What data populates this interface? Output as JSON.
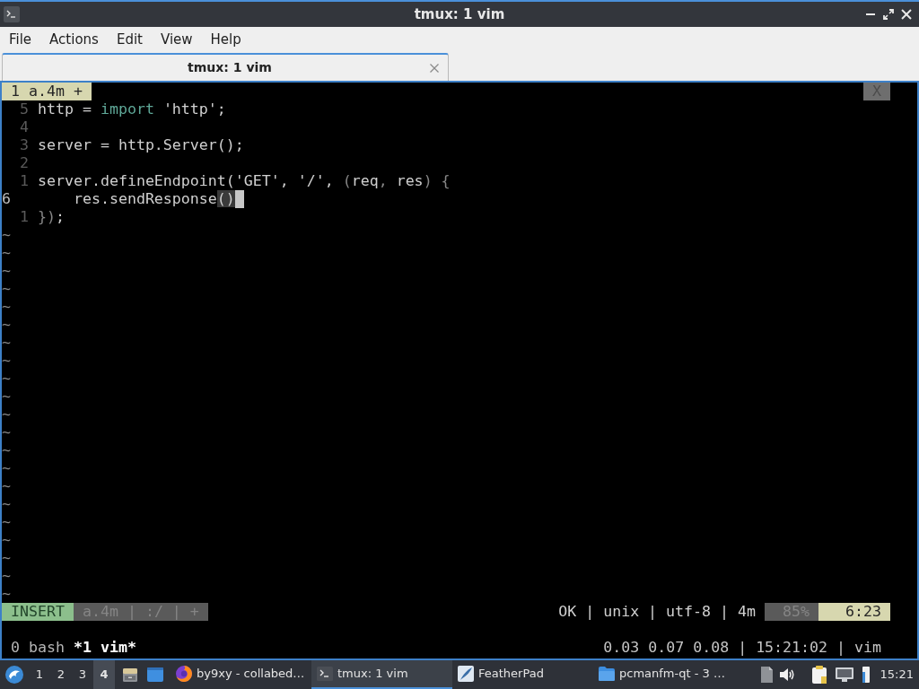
{
  "window": {
    "title": "tmux: 1 vim"
  },
  "menu": [
    {
      "label": "File"
    },
    {
      "label": "Actions"
    },
    {
      "label": "Edit"
    },
    {
      "label": "View"
    },
    {
      "label": "Help"
    }
  ],
  "tabs": [
    {
      "label": "tmux: 1 vim",
      "selected": true
    }
  ],
  "vim": {
    "tabline": {
      "tabs": [
        {
          "label": "1 a.4m +",
          "selected": true
        }
      ],
      "close_label": "X"
    },
    "lines": [
      {
        "number": "5",
        "current": false,
        "segments": [
          {
            "text": "http = ",
            "kind": "plain"
          },
          {
            "text": "import",
            "kind": "keyword"
          },
          {
            "text": " 'http';",
            "kind": "plain"
          }
        ]
      },
      {
        "number": "4",
        "current": false
      },
      {
        "number": "3",
        "current": false,
        "segments": [
          {
            "text": "server = http.Server();",
            "kind": "plain"
          }
        ]
      },
      {
        "number": "2",
        "current": false
      },
      {
        "number": "1",
        "current": false,
        "segments": [
          {
            "text": "server.defineEndpoint('GET', '/', ",
            "kind": "plain"
          },
          {
            "text": "(",
            "kind": "punct"
          },
          {
            "text": "req",
            "kind": "plain"
          },
          {
            "text": ", ",
            "kind": "punct"
          },
          {
            "text": "res",
            "kind": "plain"
          },
          {
            "text": ") {",
            "kind": "punct"
          }
        ]
      },
      {
        "number": "6",
        "current": true,
        "segments": [
          {
            "text": "    res.sendResponse",
            "kind": "plain"
          },
          {
            "text": "()",
            "kind": "match"
          }
        ]
      },
      {
        "number": "1",
        "current": false,
        "segments": [
          {
            "text": "})",
            "kind": "punct"
          },
          {
            "text": ";",
            "kind": "plain"
          }
        ]
      }
    ],
    "tildes": [
      "~",
      "~",
      "~",
      "~",
      "~",
      "~",
      "~",
      "~",
      "~",
      "~",
      "~",
      "~",
      "~",
      "~",
      "~",
      "~",
      "~",
      "~",
      "~",
      "~",
      "~"
    ],
    "statusline": {
      "mode": "INSERT",
      "file_info": "a.4m | :/ | +",
      "file_format": "OK | unix | utf-8 | 4m",
      "percent": "85%",
      "position": "6:23"
    }
  },
  "tmux": {
    "windows": [
      {
        "label": "0 bash",
        "selected": false
      },
      {
        "label": "*1 vim*",
        "selected": true
      }
    ],
    "status_right": "0.03 0.07 0.08 | 15:21:02 | vim"
  },
  "taskbar": {
    "desktops": [
      {
        "label": "1",
        "selected": false
      },
      {
        "label": "2",
        "selected": false
      },
      {
        "label": "3",
        "selected": false
      },
      {
        "label": "4",
        "selected": true
      }
    ],
    "tasks": [
      {
        "label": "by9xy - collabed…",
        "kind": "browser",
        "selected": false
      },
      {
        "label": "tmux: 1 vim",
        "kind": "terminal",
        "selected": true
      },
      {
        "label": "FeatherPad",
        "kind": "editor",
        "selected": false
      },
      {
        "label": "pcmanfm-qt - 3 …",
        "kind": "folder",
        "selected": false
      }
    ],
    "clock": "15:21"
  }
}
